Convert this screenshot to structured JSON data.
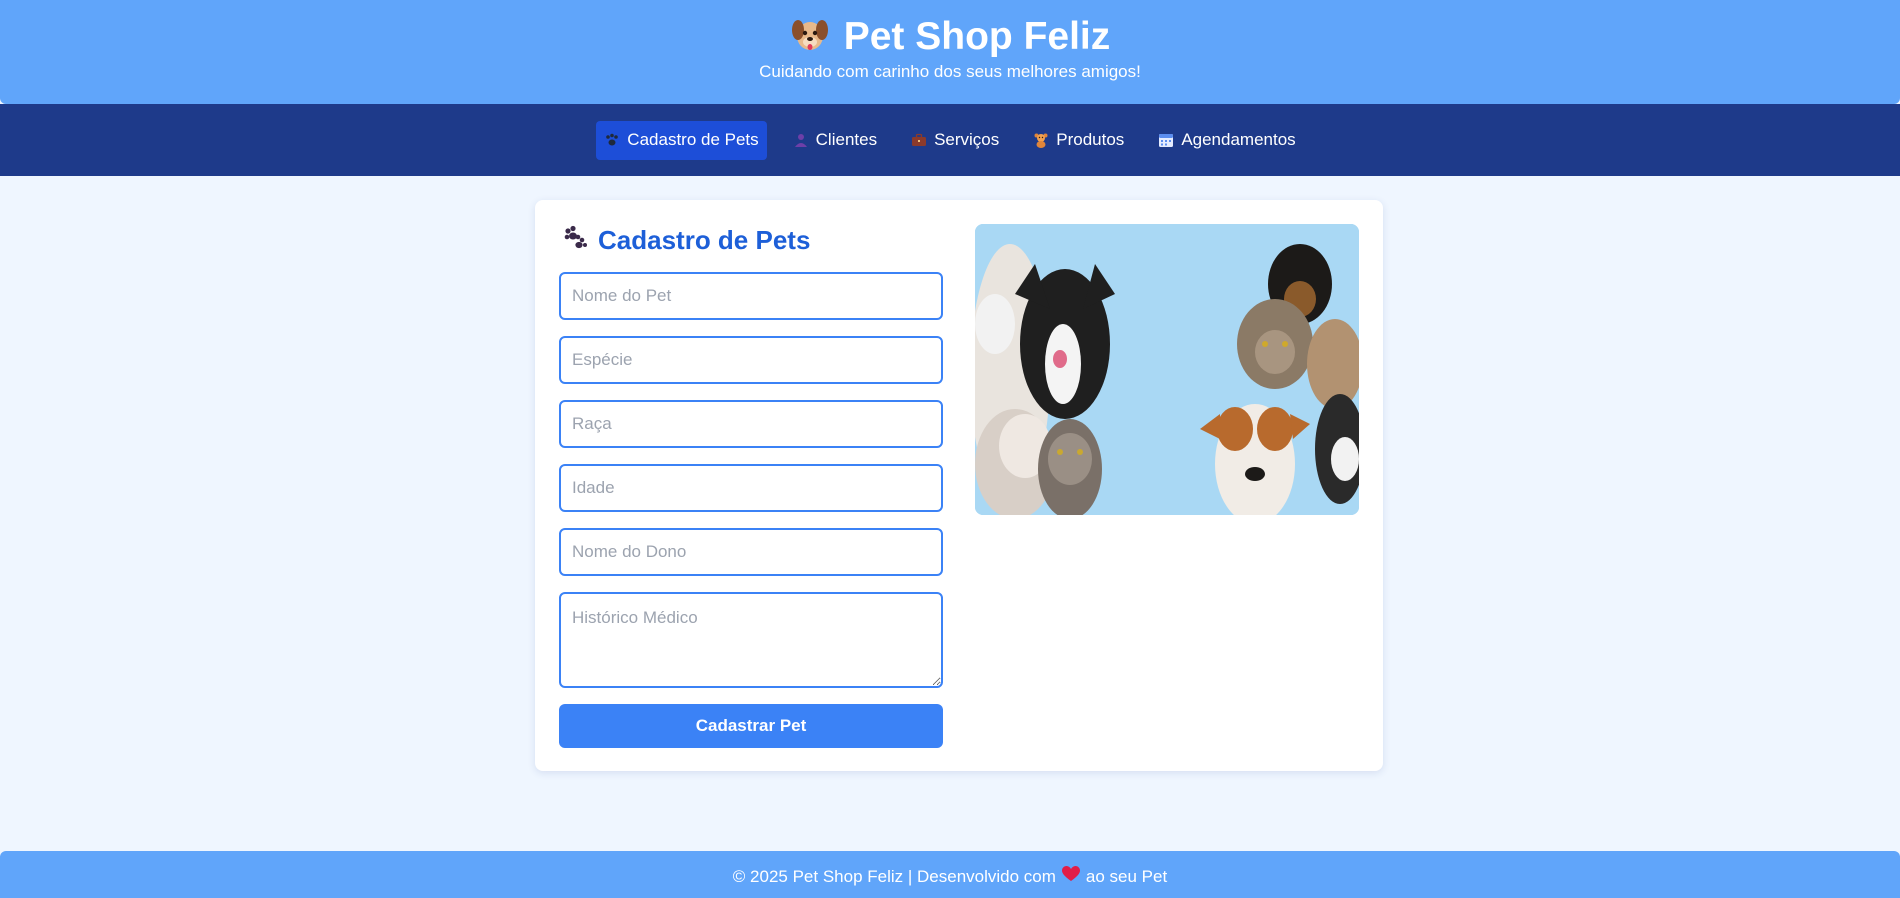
{
  "header": {
    "title": "Pet Shop Feliz",
    "subtitle": "Cuidando com carinho dos seus melhores amigos!",
    "logo_icon": "dog-face-icon"
  },
  "nav": {
    "items": [
      {
        "label": "Cadastro de Pets",
        "icon": "paw-icon",
        "active": true
      },
      {
        "label": "Clientes",
        "icon": "person-icon",
        "active": false
      },
      {
        "label": "Serviços",
        "icon": "briefcase-icon",
        "active": false
      },
      {
        "label": "Produtos",
        "icon": "teddy-bear-icon",
        "active": false
      },
      {
        "label": "Agendamentos",
        "icon": "calendar-icon",
        "active": false
      }
    ]
  },
  "form": {
    "title": "Cadastro de Pets",
    "title_icon": "paw-icon",
    "fields": [
      {
        "placeholder": "Nome do Pet",
        "value": ""
      },
      {
        "placeholder": "Espécie",
        "value": ""
      },
      {
        "placeholder": "Raça",
        "value": ""
      },
      {
        "placeholder": "Idade",
        "value": ""
      },
      {
        "placeholder": "Nome do Dono",
        "value": ""
      },
      {
        "placeholder": "Histórico Médico",
        "value": ""
      }
    ],
    "submit_label": "Cadastrar Pet"
  },
  "photo": {
    "subject": "group of dogs and cats on a light blue background"
  },
  "footer": {
    "text_before": "© 2025 Pet Shop Feliz | Desenvolvido com",
    "heart_icon": "heart-icon",
    "text_after": "ao seu Pet"
  },
  "colors": {
    "header_bg": "#60a5fa",
    "nav_bg": "#1e3a8a",
    "nav_active_bg": "#1d4ed8",
    "page_bg": "#eff6ff",
    "accent": "#3b82f6",
    "title_color": "#1d5fd8"
  }
}
